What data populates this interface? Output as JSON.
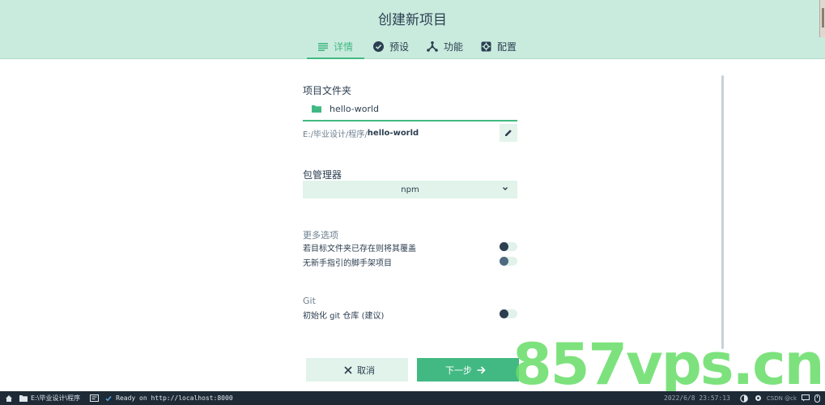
{
  "header": {
    "title": "创建新项目",
    "tabs": [
      {
        "label": "详情",
        "icon": "list-icon",
        "active": true
      },
      {
        "label": "预设",
        "icon": "check-circle-icon",
        "active": false
      },
      {
        "label": "功能",
        "icon": "hub-icon",
        "active": false
      },
      {
        "label": "配置",
        "icon": "gear-icon",
        "active": false
      }
    ]
  },
  "form": {
    "folder_label": "项目文件夹",
    "folder_value": "hello-world",
    "path_prefix": "E:/毕业设计/程序/",
    "path_name": "hello-world",
    "package_manager_label": "包管理器",
    "package_manager_value": "npm",
    "more_options_title": "更多选项",
    "option_overwrite": "若目标文件夹已存在则将其覆盖",
    "option_no_guide": "无新手指引的脚手架项目",
    "git_title": "Git",
    "option_git_init": "初始化 git 仓库 (建议)"
  },
  "actions": {
    "cancel_label": "取消",
    "next_label": "下一步"
  },
  "watermark": "857vps.cn",
  "statusbar": {
    "folder": "E:\\毕业设计\\程序",
    "ready": "Ready on http://localhost:8000",
    "datetime": "2022/6/8  23:57:13",
    "csdn": "CSDN @ck"
  },
  "colors": {
    "accent": "#42b983",
    "header_bg": "#c9ebde",
    "text": "#2c3e50",
    "statusbar_bg": "#1e2b37"
  }
}
